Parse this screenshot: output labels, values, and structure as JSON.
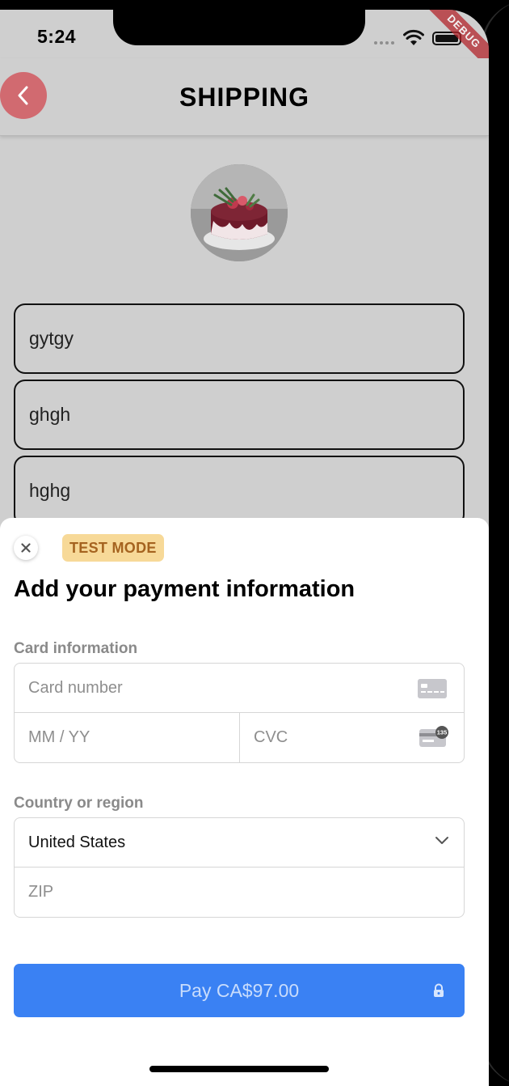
{
  "status_bar": {
    "time": "5:24",
    "debug_label": "DEBUG"
  },
  "app_bar": {
    "title": "SHIPPING"
  },
  "form": {
    "fields": [
      "gytgy",
      "ghgh",
      "hghg"
    ]
  },
  "payment_sheet": {
    "badge": "TEST MODE",
    "title": "Add your payment information",
    "card_section_label": "Card information",
    "card_number_placeholder": "Card number",
    "expiry_placeholder": "MM / YY",
    "cvc_placeholder": "CVC",
    "cvc_icon_text": "135",
    "country_section_label": "Country or region",
    "country_value": "United States",
    "zip_placeholder": "ZIP",
    "pay_label": "Pay CA$97.00"
  },
  "colors": {
    "back_button": "#d16a70",
    "pay_button": "#3a81f3",
    "badge_bg": "#f7d998",
    "badge_text": "#a5631f"
  }
}
